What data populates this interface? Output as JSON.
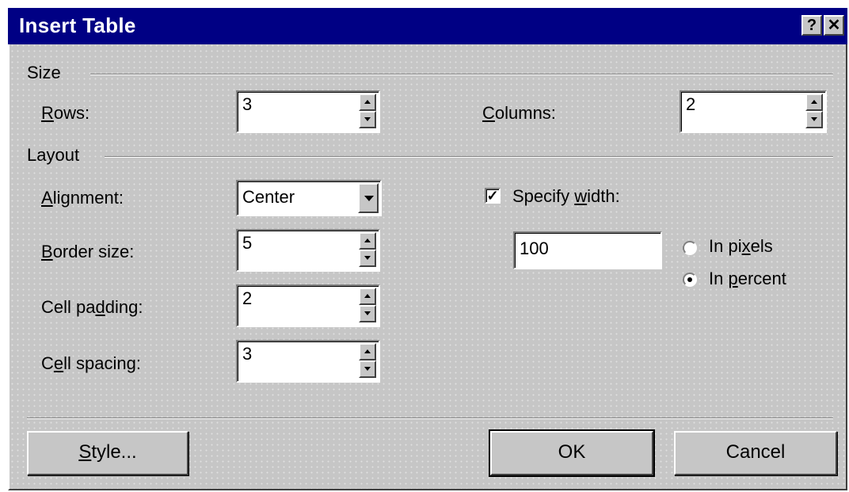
{
  "window": {
    "title": "Insert Table",
    "help_button": "?",
    "close_button": "✕"
  },
  "size": {
    "group_label": "Size",
    "rows_label_hotkey": "R",
    "rows_label_rest": "ows:",
    "rows_value": "3",
    "columns_label_hotkey": "C",
    "columns_label_rest": "olumns:",
    "columns_value": "2"
  },
  "layout": {
    "group_label": "Layout",
    "alignment_label_hotkey": "A",
    "alignment_label_rest": "lignment:",
    "alignment_value": "Center",
    "border_label_hotkey": "B",
    "border_label_rest": "order size:",
    "border_value": "5",
    "padding_label_pre": "Cell pa",
    "padding_label_hotkey": "d",
    "padding_label_post": "ding:",
    "padding_value": "2",
    "spacing_label_pre": "C",
    "spacing_label_hotkey": "e",
    "spacing_label_post": "ll spacing:",
    "spacing_value": "3",
    "specify_width_checked": true,
    "specify_width_check_glyph": "✓",
    "specify_width_pre": "Specify ",
    "specify_width_hotkey": "w",
    "specify_width_post": "idth:",
    "width_value": "100",
    "pixels_pre": "In pi",
    "pixels_hotkey": "x",
    "pixels_post": "els",
    "percent_pre": "In ",
    "percent_hotkey": "p",
    "percent_post": "ercent",
    "selected_unit": "percent"
  },
  "buttons": {
    "style_hotkey": "S",
    "style_rest": "tyle...",
    "ok": "OK",
    "cancel": "Cancel"
  }
}
